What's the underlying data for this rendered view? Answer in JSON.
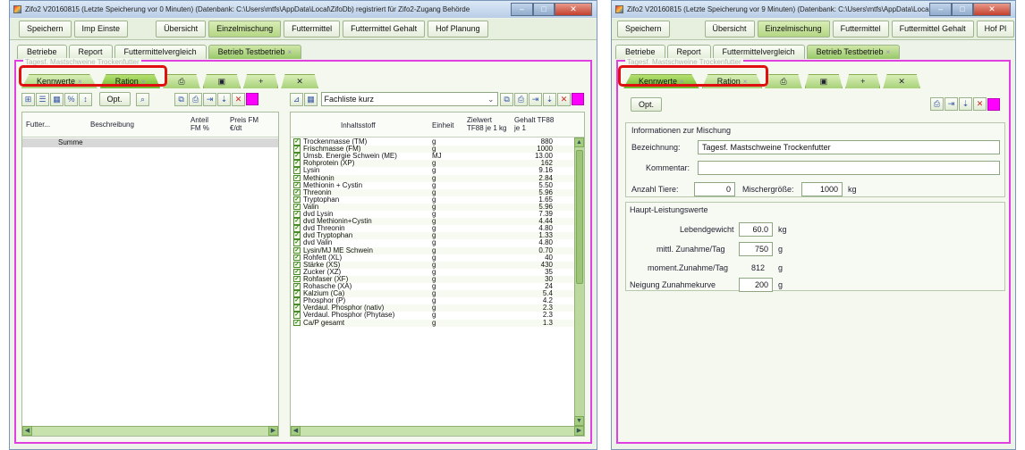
{
  "left_window": {
    "title": "Zifo2 V20160815 (Letzte Speicherung vor 0 Minuten) (Datenbank: C:\\Users\\mtfs\\AppData\\Local\\ZifoDb) registriert für Zifo2-Zugang Behörde",
    "toolbar": [
      "Speichern",
      "Imp Einste",
      "Übersicht",
      "Einzelmischung",
      "Futtermittel",
      "Futtermittel Gehalt",
      "Hof Planung"
    ],
    "toolbar_active": 3,
    "tabs1": [
      "Betriebe",
      "Report",
      "Futtermittelvergleich",
      "Betrieb Testbetrieb"
    ],
    "tab_close": "×",
    "faded_label": "Tagesf. Mastschweine Trockenfutter",
    "tabs2": [
      "Kennwerte",
      "Ration"
    ],
    "left_panel": {
      "opt_label": "Opt.",
      "headers": [
        "Futter...",
        "Beschreibung",
        "Anteil FM %",
        "Preis FM €/dt"
      ],
      "summe_label": "Summe"
    },
    "right_panel": {
      "dropdown_value": "Fachliste kurz",
      "headers": [
        "Inhaltsstoff",
        "Einheit",
        "Zielwert TF88 je 1 kg",
        "Gehalt TF88 je 1"
      ],
      "rows": [
        {
          "name": "Trockenmasse (TM)",
          "unit": "g",
          "value": "880"
        },
        {
          "name": "Frischmasse (FM)",
          "unit": "g",
          "value": "1000"
        },
        {
          "name": "Umsb. Energie Schwein (ME)",
          "unit": "MJ",
          "value": "13.00"
        },
        {
          "name": "Rohprotein (XP)",
          "unit": "g",
          "value": "162"
        },
        {
          "name": "Lysin",
          "unit": "g",
          "value": "9.16"
        },
        {
          "name": "Methionin",
          "unit": "g",
          "value": "2.84"
        },
        {
          "name": "Methionin + Cystin",
          "unit": "g",
          "value": "5.50"
        },
        {
          "name": "Threonin",
          "unit": "g",
          "value": "5.96"
        },
        {
          "name": "Tryptophan",
          "unit": "g",
          "value": "1.65"
        },
        {
          "name": "Valin",
          "unit": "g",
          "value": "5.96"
        },
        {
          "name": "dvd Lysin",
          "unit": "g",
          "value": "7.39"
        },
        {
          "name": "dvd Methionin+Cystin",
          "unit": "g",
          "value": "4.44"
        },
        {
          "name": "dvd Threonin",
          "unit": "g",
          "value": "4.80"
        },
        {
          "name": "dvd Tryptophan",
          "unit": "g",
          "value": "1.33"
        },
        {
          "name": "dvd Valin",
          "unit": "g",
          "value": "4.80"
        },
        {
          "name": "Lysin/MJ ME Schwein",
          "unit": "g",
          "value": "0.70"
        },
        {
          "name": "Rohfett (XL)",
          "unit": "g",
          "value": "40"
        },
        {
          "name": "Stärke (XS)",
          "unit": "g",
          "value": "430"
        },
        {
          "name": "Zucker (XZ)",
          "unit": "g",
          "value": "35"
        },
        {
          "name": "Rohfaser (XF)",
          "unit": "g",
          "value": "30"
        },
        {
          "name": "Rohasche (XA)",
          "unit": "g",
          "value": "24"
        },
        {
          "name": "Kalzium (Ca)",
          "unit": "g",
          "value": "5.4"
        },
        {
          "name": "Phosphor (P)",
          "unit": "g",
          "value": "4.2"
        },
        {
          "name": "Verdaul. Phosphor (nativ)",
          "unit": "g",
          "value": "2.3"
        },
        {
          "name": "Verdaul. Phosphor (Phytase)",
          "unit": "g",
          "value": "2.3"
        },
        {
          "name": "Ca/P gesamt",
          "unit": "g",
          "value": "1.3"
        }
      ]
    }
  },
  "right_window": {
    "title": "Zifo2 V20160815 (Letzte Speicherung vor 9 Minuten) (Datenbank: C:\\Users\\mtfs\\AppData\\Local\\...",
    "toolbar": [
      "Speichern",
      "Übersicht",
      "Einzelmischung",
      "Futtermittel",
      "Futtermittel Gehalt",
      "Hof Pl"
    ],
    "toolbar_active": 2,
    "tabs1": [
      "Betriebe",
      "Report",
      "Futtermittelvergleich",
      "Betrieb Testbetrieb"
    ],
    "tab_close": "×",
    "faded_label": "Tagesf. Mastschweine Trockenfutter",
    "tabs2": [
      "Kennwerte",
      "Ration"
    ],
    "opt_label": "Opt.",
    "info_group": "Informationen zur Mischung",
    "bezeichnung_label": "Bezeichnung:",
    "bezeichnung_value": "Tagesf. Mastschweine Trockenfutter",
    "kommentar_label": "Kommentar:",
    "kommentar_value": "",
    "anzahl_label": "Anzahl Tiere:",
    "anzahl_value": "0",
    "mischer_label": "Mischergröße:",
    "mischer_value": "1000",
    "mischer_unit": "kg",
    "leistung_group": "Haupt-Leistungswerte",
    "lebend_label": "Lebendgewicht",
    "lebend_value": "60.0",
    "lebend_unit": "kg",
    "zunahme_label": "mittl. Zunahme/Tag",
    "zunahme_value": "750",
    "zunahme_unit": "g",
    "moment_label": "moment.Zunahme/Tag",
    "moment_value": "812",
    "moment_unit": "g",
    "neigung_label": "Neigung Zunahmekurve",
    "neigung_value": "200",
    "neigung_unit": "g"
  },
  "icons": {
    "print": "printer-icon",
    "save": "save-icon",
    "add": "add-icon",
    "close": "close-icon"
  }
}
